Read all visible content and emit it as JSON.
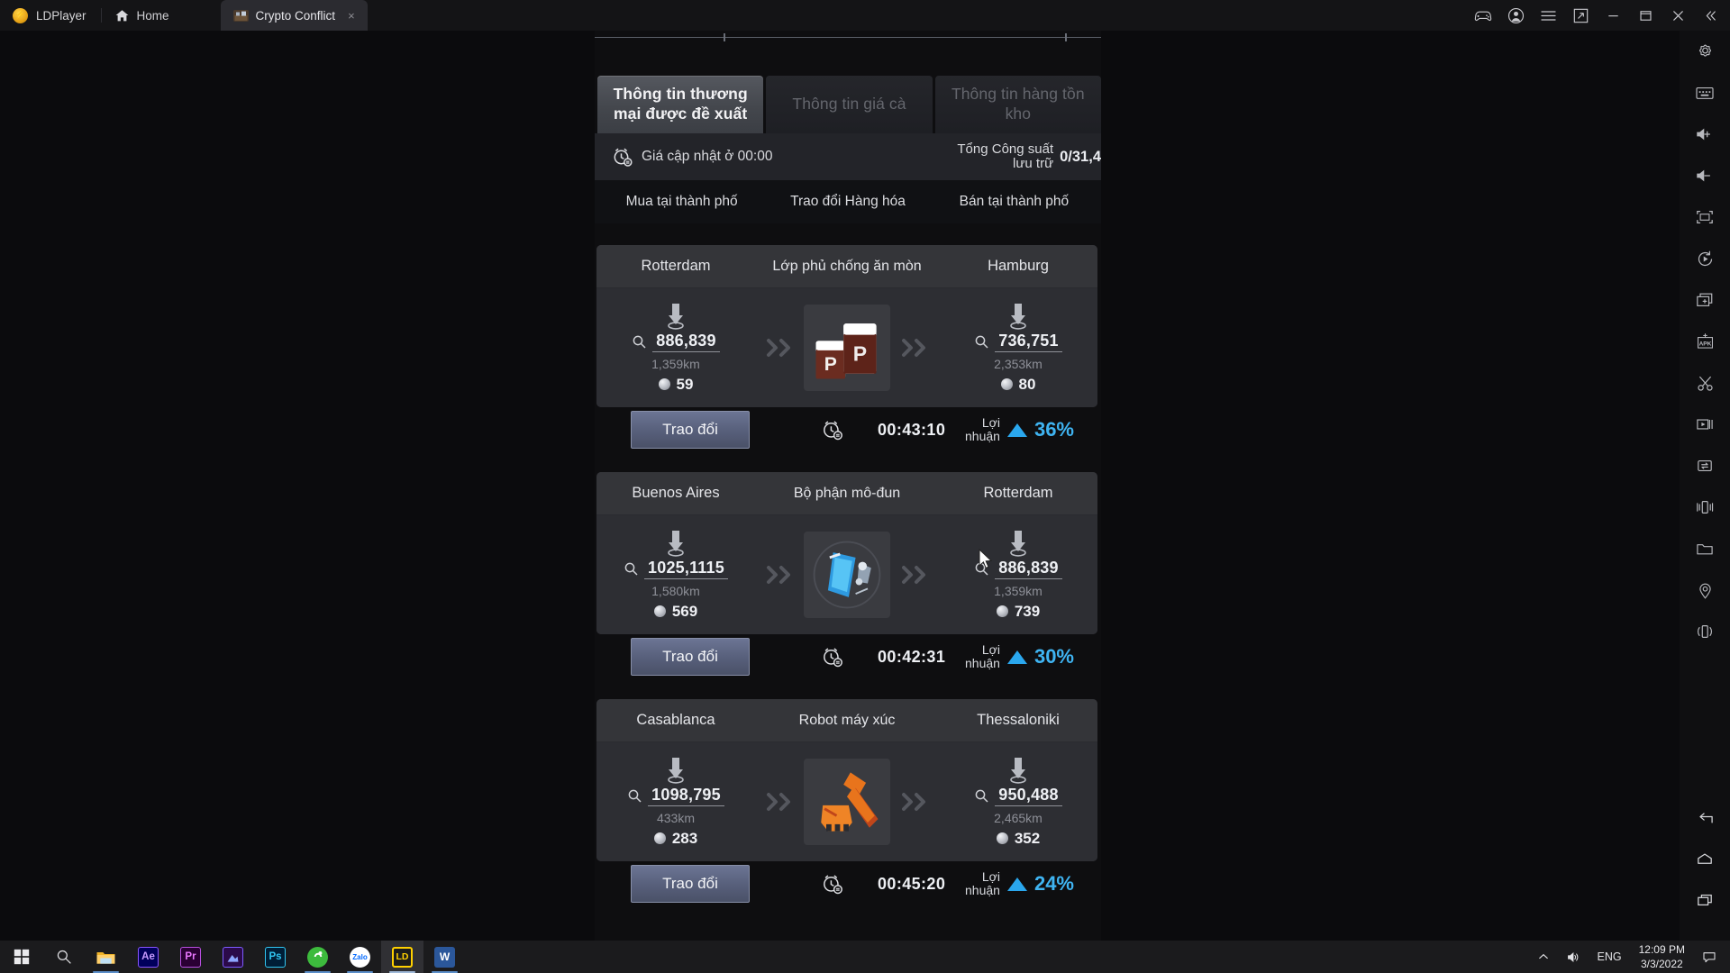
{
  "titlebar": {
    "brand": "LDPlayer",
    "tabs": [
      {
        "label": "Home",
        "icon": "home-icon",
        "active": false
      },
      {
        "label": "Crypto Conflict",
        "icon": "game-thumb-icon",
        "active": true,
        "close": "×"
      }
    ],
    "controls": [
      {
        "name": "gamepad-icon"
      },
      {
        "name": "account-icon"
      },
      {
        "name": "menu-icon"
      },
      {
        "name": "screenshot-icon"
      },
      {
        "name": "minimize-icon"
      },
      {
        "name": "maximize-icon"
      },
      {
        "name": "close-icon"
      },
      {
        "name": "collapse-icon"
      }
    ]
  },
  "game": {
    "main_tabs": [
      {
        "label": "Thông tin thương mại được đề xuất",
        "selected": true
      },
      {
        "label": "Thông tin giá cà",
        "selected": false
      },
      {
        "label": "Thông tin hàng tồn kho",
        "selected": false
      }
    ],
    "info_strip": {
      "alarm_icon": "alarm-clock-icon",
      "update_text": "Giá cập nhật ở 00:00",
      "capacity_label": "Tổng Công suất lưu trữ",
      "capacity_value": "0/31,4"
    },
    "sub_tabs": [
      {
        "label": "Mua tại thành phố"
      },
      {
        "label": "Trao đổi Hàng hóa"
      },
      {
        "label": "Bán tại thành phố"
      }
    ],
    "profit_label": "Lợi nhuận",
    "trade_button_label": "Trao đổi",
    "trades": [
      {
        "origin_city": "Rotterdam",
        "item_name": "Lớp phủ chống ăn mòn",
        "dest_city": "Hamburg",
        "origin_price": "886,839",
        "origin_distance": "1,359km",
        "origin_qty": "59",
        "dest_price": "736,751",
        "dest_distance": "2,353km",
        "dest_qty": "80",
        "timer": "00:43:10",
        "profit": "36%",
        "thumb": "paint-cans-icon"
      },
      {
        "origin_city": "Buenos Aires",
        "item_name": "Bộ phận mô-đun",
        "dest_city": "Rotterdam",
        "origin_price": "1025,1115",
        "origin_distance": "1,580km",
        "origin_qty": "569",
        "dest_price": "886,839",
        "dest_distance": "1,359km",
        "dest_qty": "739",
        "timer": "00:42:31",
        "profit": "30%",
        "thumb": "module-part-icon"
      },
      {
        "origin_city": "Casablanca",
        "item_name": "Robot máy xúc",
        "dest_city": "Thessaloniki",
        "origin_price": "1098,795",
        "origin_distance": "433km",
        "origin_qty": "283",
        "dest_price": "950,488",
        "dest_distance": "2,465km",
        "dest_qty": "352",
        "timer": "00:45:20",
        "profit": "24%",
        "thumb": "excavator-robot-icon"
      }
    ],
    "accent_blue": "#3fb4f2",
    "button_blue": "#59617d"
  },
  "sidebar": {
    "items": [
      {
        "name": "settings-gear-icon"
      },
      {
        "name": "keyboard-icon"
      },
      {
        "name": "volume-up-icon"
      },
      {
        "name": "volume-down-icon"
      },
      {
        "name": "fullscreen-icon"
      },
      {
        "name": "macro-record-icon"
      },
      {
        "name": "multi-instance-icon"
      },
      {
        "name": "install-apk-icon"
      },
      {
        "name": "scissors-screenshot-icon"
      },
      {
        "name": "video-record-icon"
      },
      {
        "name": "sync-operation-icon"
      },
      {
        "name": "shake-icon"
      },
      {
        "name": "folder-shared-icon"
      },
      {
        "name": "location-icon"
      },
      {
        "name": "rotate-screen-icon"
      }
    ],
    "nav": [
      {
        "name": "android-back-icon"
      },
      {
        "name": "android-home-icon"
      },
      {
        "name": "android-recents-icon"
      }
    ]
  },
  "taskbar": {
    "apps": [
      {
        "name": "start-button",
        "label": ""
      },
      {
        "name": "search-icon",
        "label": ""
      },
      {
        "name": "file-explorer-icon",
        "label": ""
      },
      {
        "name": "after-effects-icon",
        "label": "Ae",
        "color": "#00005b",
        "text": "#d6a0ff",
        "border": "#9b5cff"
      },
      {
        "name": "premiere-pro-icon",
        "label": "Pr",
        "color": "#2a0034",
        "text": "#ea77ff",
        "border": "#c44fe8"
      },
      {
        "name": "lightroom-icon",
        "label": "",
        "color": "#2b0a4a",
        "text": "#b8c7ff",
        "border": "#7d5cff"
      },
      {
        "name": "photoshop-icon",
        "label": "Ps",
        "color": "#001e36",
        "text": "#31c5f0",
        "border": "#31c5f0"
      },
      {
        "name": "green-app-icon",
        "label": "",
        "color": "#3dbb3d",
        "text": "#ffffff",
        "border": "#3dbb3d"
      },
      {
        "name": "zalo-icon",
        "label": "Zalo",
        "color": "#ffffff",
        "text": "#0068ff",
        "border": "#e3e3e3"
      },
      {
        "name": "ldplayer-icon",
        "label": "LD",
        "color": "#1c1c1c",
        "text": "#ffd000",
        "border": "#ffd000"
      },
      {
        "name": "word-icon",
        "label": "W",
        "color": "#2b579a",
        "text": "#ffffff",
        "border": "#2b579a"
      }
    ],
    "tray": {
      "chevron": "show-hidden-icons",
      "volume": "volume-icon",
      "language": "ENG",
      "time": "12:09 PM",
      "date": "3/3/2022",
      "notifications": "notification-icon"
    }
  }
}
